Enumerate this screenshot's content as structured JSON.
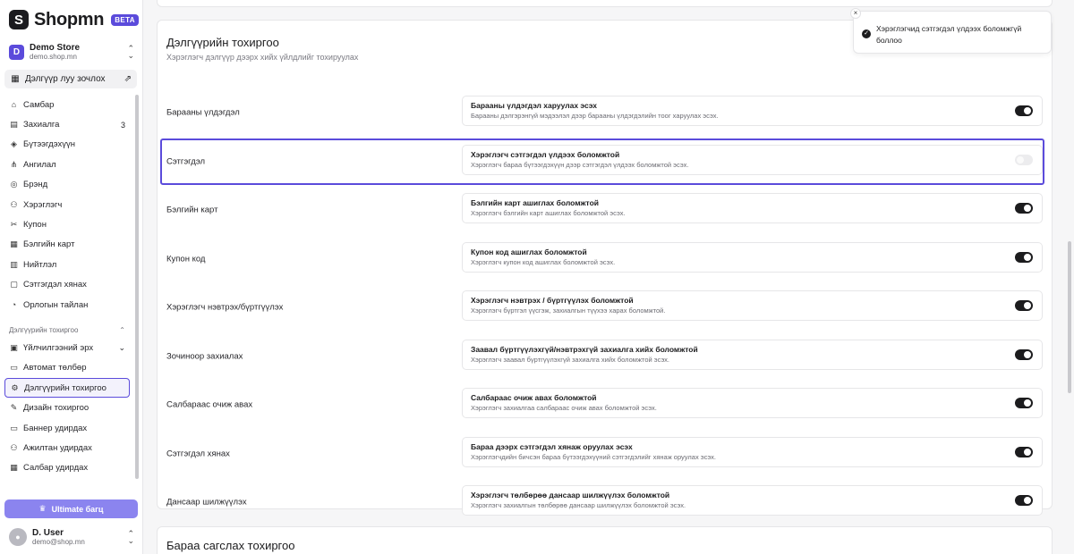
{
  "brand": {
    "name": "Shopmn",
    "badge": "BETA",
    "mark": "S"
  },
  "store": {
    "initial": "D",
    "name": "Demo Store",
    "url": "demo.shop.mn"
  },
  "shop_link": {
    "label": "Дэлгүүр луу зочлох"
  },
  "nav": {
    "items": [
      {
        "label": "Самбар",
        "icon": "home-icon",
        "glyph": "⌂"
      },
      {
        "label": "Захиалга",
        "icon": "orders-icon",
        "glyph": "▤",
        "count": "3"
      },
      {
        "label": "Бүтээгдэхүүн",
        "icon": "box-icon",
        "glyph": "◈"
      },
      {
        "label": "Ангилал",
        "icon": "category-icon",
        "glyph": "⋔"
      },
      {
        "label": "Брэнд",
        "icon": "brand-icon",
        "glyph": "◎"
      },
      {
        "label": "Хэрэглэгч",
        "icon": "users-icon",
        "glyph": "⚇"
      },
      {
        "label": "Купон",
        "icon": "coupon-icon",
        "glyph": "✂"
      },
      {
        "label": "Бэлгийн карт",
        "icon": "gift-icon",
        "glyph": "▦"
      },
      {
        "label": "Нийтлэл",
        "icon": "article-icon",
        "glyph": "▥"
      },
      {
        "label": "Сэтгэгдэл хянах",
        "icon": "review-icon",
        "glyph": "▢"
      },
      {
        "label": "Орлогын тайлан",
        "icon": "report-icon",
        "glyph": "◔"
      }
    ],
    "section_label": "Дэлгүүрийн тохиргоо",
    "settings_items": [
      {
        "label": "Үйлчилгээний эрх",
        "icon": "subscription-icon",
        "glyph": "▣",
        "chevron": "⌄"
      },
      {
        "label": "Автомат төлбөр",
        "icon": "payment-icon",
        "glyph": "▭"
      },
      {
        "label": "Дэлгүүрийн тохиргоо",
        "icon": "settings-icon",
        "glyph": "⚙"
      },
      {
        "label": "Дизайн тохиргоо",
        "icon": "brush-icon",
        "glyph": "✎"
      },
      {
        "label": "Баннер удирдах",
        "icon": "banner-icon",
        "glyph": "▭"
      },
      {
        "label": "Ажилтан удирдах",
        "icon": "staff-icon",
        "glyph": "⚇"
      },
      {
        "label": "Салбар удирдах",
        "icon": "branch-icon",
        "glyph": "▦"
      }
    ],
    "active_index": 2
  },
  "upgrade": {
    "label": "Ultimate багц"
  },
  "user": {
    "name": "D. User",
    "email": "demo@shop.mn"
  },
  "settings": {
    "title": "Дэлгүүрийн тохиргоо",
    "subtitle": "Хэрэглэгч дэлгүүр дээрх хийх үйлдлийг тохируулах",
    "rows": [
      {
        "label": "Барааны үлдэгдэл",
        "title": "Барааны үлдэгдэл харуулах эсэх",
        "desc": "Барааны дэлгэрэнгүй мэдээлэл дээр барааны үлдэгдэлийн тоог харуулах эсэх.",
        "on": true
      },
      {
        "label": "Сэтгэгдэл",
        "title": "Хэрэглэгч сэтгэгдэл үлдээх боломжтой",
        "desc": "Хэрэглэгч бараа бүтээгдэхүүн дээр сэтгэгдэл үлдээх боломжтой эсэх.",
        "on": false
      },
      {
        "label": "Бэлгийн карт",
        "title": "Бэлгийн карт ашиглах боломжтой",
        "desc": "Хэрэглэгч бэлгийн карт ашиглах боломжтой эсэх.",
        "on": true
      },
      {
        "label": "Купон код",
        "title": "Купон код ашиглах боломжтой",
        "desc": "Хэрэглэгч купон код ашиглах боломжтой эсэх.",
        "on": true
      },
      {
        "label": "Хэрэглэгч нэвтрэх/бүртгүүлэх",
        "title": "Хэрэглэгч нэвтрэх / бүртгүүлэх боломжтой",
        "desc": "Хэрэглэгч бүртгэл үүсгэж, захиалгын түүхээ харах боломжтой.",
        "on": true
      },
      {
        "label": "Зочиноор захиалах",
        "title": "Заавал бүртгүүлэхгүй/нэвтрэхгүй захиалга хийх боломжтой",
        "desc": "Хэрэглэгч заавал бүртгүүлэхгүй захиалга хийх боломжтой эсэх.",
        "on": true
      },
      {
        "label": "Салбараас очиж авах",
        "title": "Салбараас очиж авах боломжтой",
        "desc": "Хэрэглэгч захиалгаа салбараас очиж авах боломжтой эсэх.",
        "on": true
      },
      {
        "label": "Сэтгэгдэл хянах",
        "title": "Бараа дээрх сэтгэгдэл хянаж оруулах эсэх",
        "desc": "Хэрэглэгчдийн бичсэн бараа бүтээгдэхүүний сэтгэгдэлийг хянаж оруулах эсэх.",
        "on": true
      },
      {
        "label": "Дансаар шилжүүлэх",
        "title": "Хэрэглэгч төлбөрөө дансаар шилжүүлэх боломжтой",
        "desc": "Хэрэглэгч захиалгын төлбөрөө дансаар шилжүүлэх боломжтой эсэх.",
        "on": true
      }
    ],
    "highlighted_row": 1
  },
  "next_section": {
    "title": "Бараа сагслах тохиргоо"
  },
  "toast": {
    "message": "Хэрэглэгчид сэтгэгдэл үлдээх боломжгүй боллоо",
    "close": "×",
    "check": "✓"
  },
  "colors": {
    "accent": "#5b4bdb",
    "toggle_on": "#1c1c1e",
    "toggle_off": "#ececee"
  }
}
